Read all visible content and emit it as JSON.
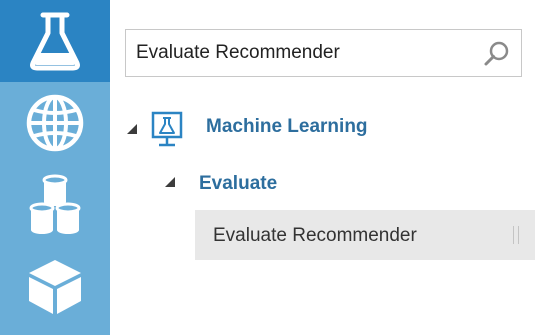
{
  "nav": {
    "items": [
      {
        "icon": "flask-icon",
        "active": true
      },
      {
        "icon": "globe-icon",
        "active": false
      },
      {
        "icon": "datasets-icon",
        "active": false
      },
      {
        "icon": "module-cube-icon",
        "active": false
      }
    ],
    "colors": {
      "rail": "#6aaed8",
      "active": "#2b84c3",
      "icon": "#ffffff"
    }
  },
  "search": {
    "value": "Evaluate Recommender",
    "icon": "search-icon"
  },
  "tree": {
    "category": {
      "label": "Machine Learning",
      "icon": "machine-learning-icon",
      "expanded": true
    },
    "subcategory": {
      "label": "Evaluate",
      "expanded": true
    },
    "modules": [
      {
        "label": "Evaluate Recommender"
      }
    ],
    "colors": {
      "heading": "#2d6e9e",
      "module_bg": "#e8e8e8"
    }
  }
}
